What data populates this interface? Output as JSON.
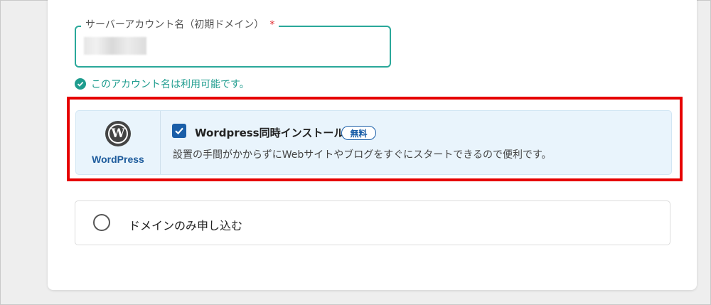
{
  "account_field": {
    "label": "サーバーアカウント名（初期ドメイン）",
    "required_mark": "*",
    "value_obscured": true,
    "status_text": "このアカウント名は利用可能です。",
    "accent_color": "#2aa89a"
  },
  "wordpress_option": {
    "logo_glyph": "W",
    "logo_text": "WordPress",
    "checked": true,
    "title": "Wordpress同時インストール",
    "badge": "無料",
    "description": "設置の手間がかからずにWebサイトやブログをすぐにスタートできるので便利です。",
    "highlight_color": "#e60000"
  },
  "domain_option": {
    "label": "ドメインのみ申し込む",
    "selected": false
  }
}
